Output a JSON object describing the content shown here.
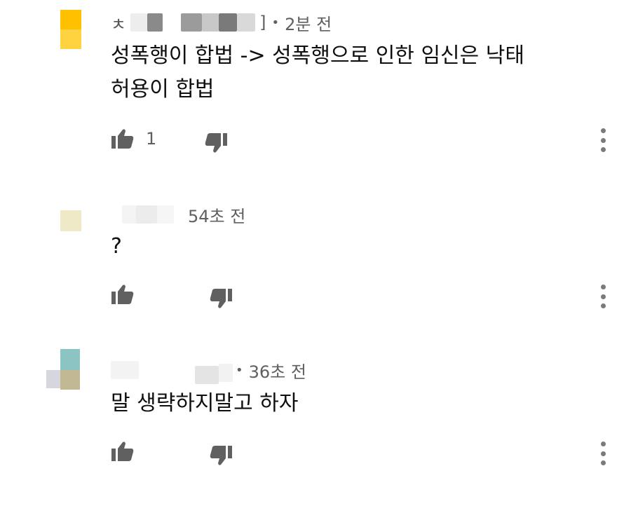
{
  "comments": [
    {
      "author_prefix": "ㅊ",
      "author_suffix": "]",
      "separator": "•",
      "time": "2분 전",
      "text": "성폭행이 합법 -> 성폭행으로 인한 임신은 낙태\n허용이 합법",
      "likes": "1",
      "avatar_colors": [
        "#ffc000",
        "#ffcf3a"
      ]
    },
    {
      "time": "54초 전",
      "text": "?",
      "avatar_colors": [
        "#efe9c8"
      ]
    },
    {
      "separator": "•",
      "time": "36초 전",
      "text": "말 생략하지말고 하자",
      "avatar_colors": [
        "#8cc3c3",
        "#c2b893",
        "#cfcfd8"
      ]
    }
  ],
  "icons": {
    "like": "thumb-up-icon",
    "dislike": "thumb-down-icon",
    "more": "more-vert-icon"
  }
}
